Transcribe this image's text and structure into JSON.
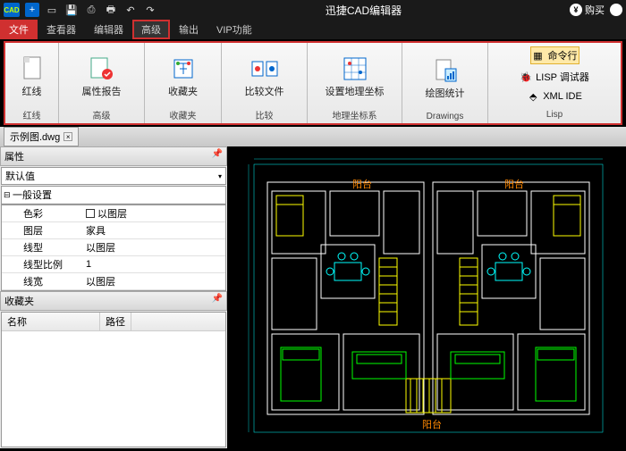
{
  "title": "迅捷CAD编辑器",
  "logo": "CAD",
  "buy": "购买",
  "tabs": [
    "文件",
    "查看器",
    "编辑器",
    "高级",
    "输出",
    "VIP功能"
  ],
  "ribbon": {
    "groups": [
      {
        "label": "红线",
        "item": "红线"
      },
      {
        "label": "高级",
        "item": "属性报告"
      },
      {
        "label": "收藏夹",
        "item": "收藏夹"
      },
      {
        "label": "比较",
        "item": "比较文件"
      },
      {
        "label": "地理坐标系",
        "item": "设置地理坐标"
      },
      {
        "label": "Drawings",
        "item": "绘图统计"
      }
    ],
    "lisp": {
      "cmd": "命令行",
      "dbg": "LISP 调试器",
      "xml": "XML IDE",
      "label": "Lisp"
    }
  },
  "doc": {
    "name": "示例图.dwg"
  },
  "props": {
    "title": "属性",
    "default": "默认值",
    "section": "一般设置",
    "rows": [
      {
        "k": "色彩",
        "v": "以图层",
        "sq": true
      },
      {
        "k": "图层",
        "v": "家具"
      },
      {
        "k": "线型",
        "v": "以图层"
      },
      {
        "k": "线型比例",
        "v": "1"
      },
      {
        "k": "线宽",
        "v": "以图层"
      }
    ]
  },
  "fav": {
    "title": "收藏夹",
    "c1": "名称",
    "c2": "路径"
  },
  "floor": {
    "labels": [
      "阳台",
      "阳台",
      "阳台"
    ]
  }
}
